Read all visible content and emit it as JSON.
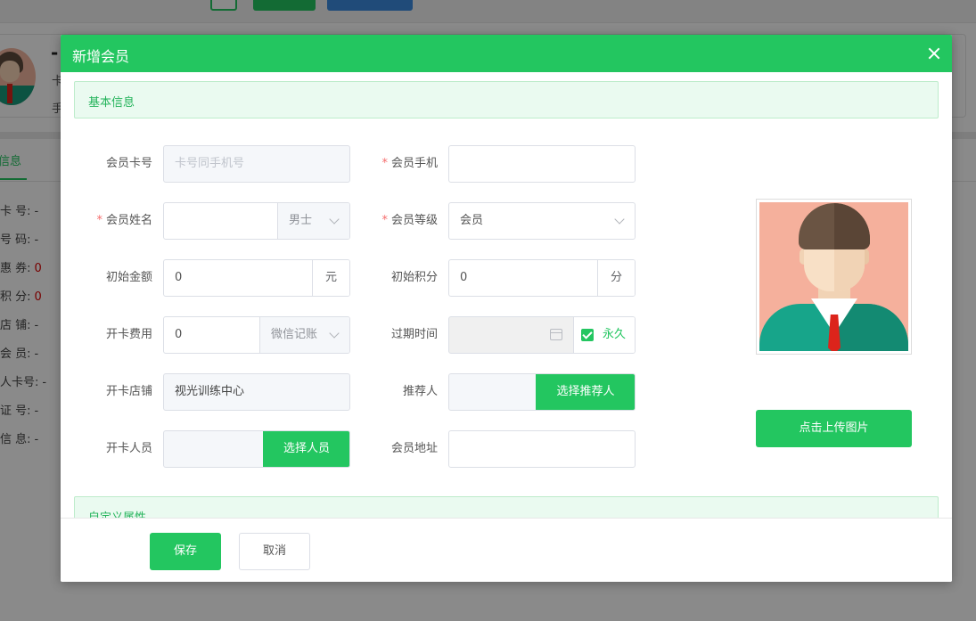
{
  "background": {
    "name_placeholder": "-",
    "card_line1": "卡",
    "card_line2": "手",
    "active_tab": "信息",
    "info_rows": [
      {
        "label": "卡 号:",
        "value": "-"
      },
      {
        "label": "号 码:",
        "value": "-"
      },
      {
        "label": "惠 券:",
        "value": "0"
      },
      {
        "label": "积 分:",
        "value": "0"
      },
      {
        "label": "店 铺:",
        "value": "-"
      },
      {
        "label": "会 员:",
        "value": "-"
      },
      {
        "label": "人卡号:",
        "value": "-"
      },
      {
        "label": "证 号:",
        "value": "-"
      },
      {
        "label": "信 息:",
        "value": "-"
      }
    ]
  },
  "modal": {
    "title": "新增会员",
    "section_basic": "基本信息",
    "section_custom": "自定义属性",
    "fields": {
      "card_no": {
        "label": "会员卡号",
        "placeholder": "卡号同手机号"
      },
      "phone": {
        "label": "会员手机",
        "value": ""
      },
      "name": {
        "label": "会员姓名",
        "value": "",
        "gender": "男士"
      },
      "level": {
        "label": "会员等级",
        "value": "会员"
      },
      "init_amount": {
        "label": "初始金额",
        "value": "0",
        "unit": "元"
      },
      "init_points": {
        "label": "初始积分",
        "value": "0",
        "unit": "分"
      },
      "card_fee": {
        "label": "开卡费用",
        "value": "0",
        "method": "微信记账"
      },
      "expire": {
        "label": "过期时间",
        "value": "",
        "forever_label": "永久",
        "forever_checked": true
      },
      "store": {
        "label": "开卡店铺",
        "value": "视光训练中心"
      },
      "referrer": {
        "label": "推荐人",
        "value": "",
        "button": "选择推荐人"
      },
      "staff": {
        "label": "开卡人员",
        "value": "",
        "button": "选择人员"
      },
      "address": {
        "label": "会员地址",
        "value": ""
      }
    },
    "upload_button": "点击上传图片",
    "save_button": "保存",
    "cancel_button": "取消"
  },
  "colors": {
    "primary_green": "#23c660",
    "required_mark": "#f56c6c",
    "secondary_blue": "#3c8be0"
  }
}
